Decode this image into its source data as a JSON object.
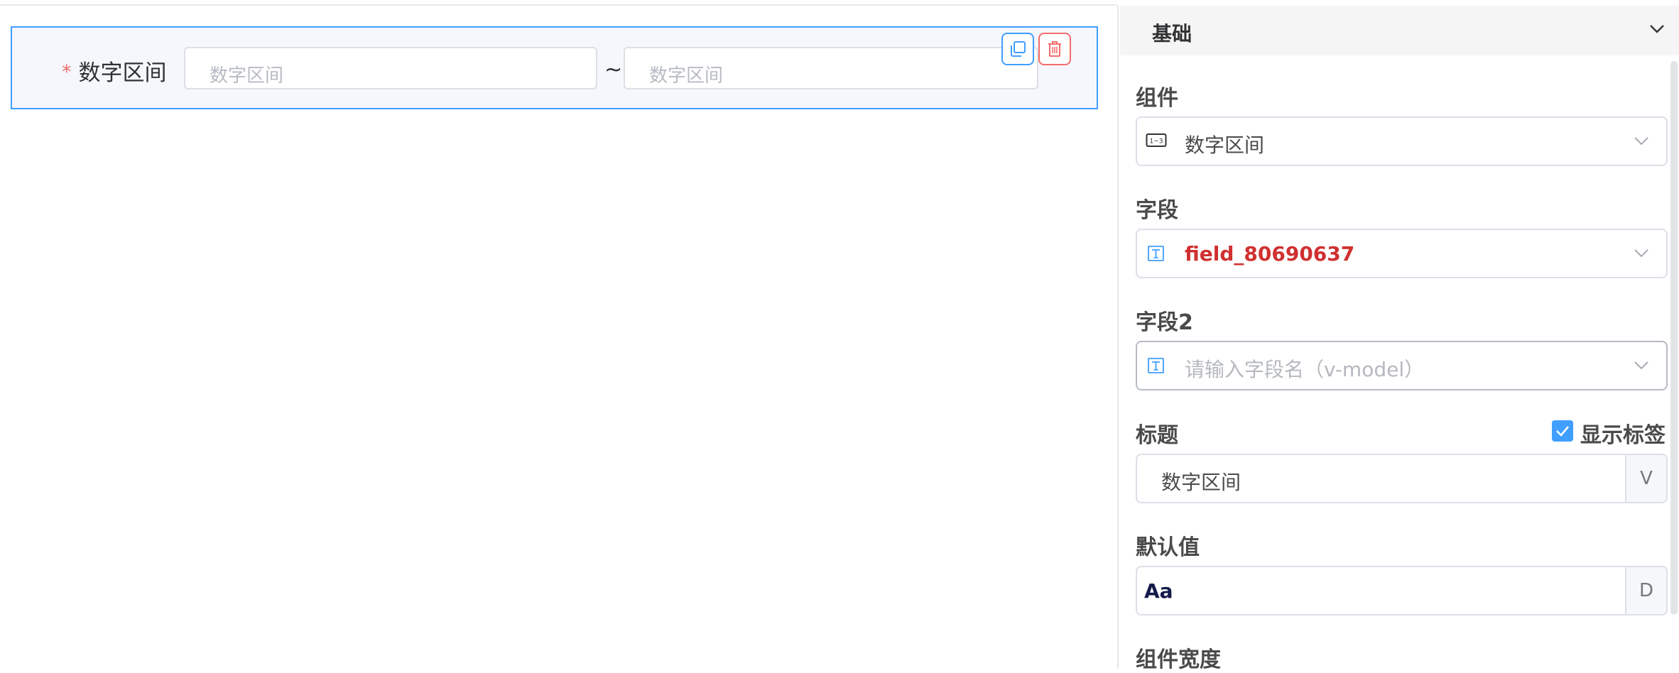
{
  "canvas": {
    "item_label": "数字区间",
    "required_mark": "*",
    "start_placeholder": "数字区间",
    "end_placeholder": "数字区间",
    "separator": "~"
  },
  "panel": {
    "section_title": "基础",
    "component": {
      "label": "组件",
      "value": "数字区间",
      "icon": "number-range-icon"
    },
    "field": {
      "label": "字段",
      "value": "field_80690637",
      "icon": "text-t-icon"
    },
    "field2": {
      "label": "字段2",
      "placeholder": "请输入字段名（v-model）",
      "icon": "text-t-icon"
    },
    "title": {
      "label": "标题",
      "value": "数字区间",
      "append": "V",
      "show_label": "显示标签",
      "show_label_checked": true
    },
    "default": {
      "label": "默认值",
      "value": "Aa",
      "append": "D"
    },
    "width": {
      "label": "组件宽度"
    }
  },
  "colors": {
    "primary": "#409eff",
    "danger": "#f56c6c",
    "field_value": "#d03030"
  }
}
